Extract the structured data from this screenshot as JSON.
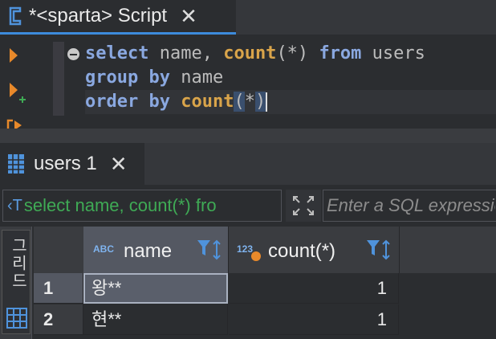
{
  "editor_tab": {
    "title": "*<sparta> Script",
    "close": "✕"
  },
  "code": {
    "line1": {
      "kw1": "select",
      "t1": " name, ",
      "fn1": "count",
      "p1": "(*)",
      "sp": " ",
      "kw2": "from",
      "t2": " users"
    },
    "line2": {
      "kw1": "group",
      "sp": " ",
      "kw2": "by",
      "t1": " name"
    },
    "line3": {
      "kw1": "order",
      "sp": " ",
      "kw2": "by",
      "sp2": " ",
      "fn1": "count",
      "p_open": "(",
      "star": "*",
      "p_close": ")"
    }
  },
  "results_tab": {
    "title": "users 1",
    "close": "✕"
  },
  "filter": {
    "icon": "‹T",
    "text": "select name, count(*) fro",
    "placeholder": "Enter a SQL expression to filter results"
  },
  "side_panel": {
    "label": "그리드"
  },
  "columns": [
    {
      "type": "ABC",
      "name": "name"
    },
    {
      "type": "123",
      "name": "count(*)"
    }
  ],
  "rows": [
    {
      "num": "1",
      "name": "왕**",
      "count": "1"
    },
    {
      "num": "2",
      "name": "현**",
      "count": "1"
    }
  ],
  "colors": {
    "accent": "#3d8bdc",
    "keyword": "#8aa8e0",
    "function": "#d9a44a",
    "filter_text": "#3faa55",
    "run_icon": "#e8892a"
  }
}
